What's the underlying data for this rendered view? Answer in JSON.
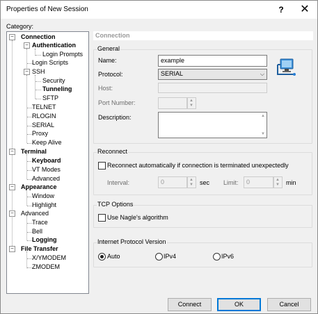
{
  "window": {
    "title": "Properties of New Session",
    "help_glyph": "?",
    "close_glyph": "✕"
  },
  "category_label": "Category:",
  "tree": {
    "connection": "Connection",
    "authentication": "Authentication",
    "login_prompts": "Login Prompts",
    "login_scripts": "Login Scripts",
    "ssh": "SSH",
    "security": "Security",
    "tunneling": "Tunneling",
    "sftp": "SFTP",
    "telnet": "TELNET",
    "rlogin": "RLOGIN",
    "serial": "SERIAL",
    "proxy": "Proxy",
    "keep_alive": "Keep Alive",
    "terminal": "Terminal",
    "keyboard": "Keyboard",
    "vt_modes": "VT Modes",
    "terminal_advanced": "Advanced",
    "appearance": "Appearance",
    "window": "Window",
    "highlight": "Highlight",
    "advanced": "Advanced",
    "trace": "Trace",
    "bell": "Bell",
    "logging": "Logging",
    "file_transfer": "File Transfer",
    "xymodem": "X/YMODEM",
    "zmodem": "ZMODEM",
    "collapse_glyph": "−"
  },
  "section_header": "Connection",
  "general": {
    "title": "General",
    "name_label": "Name:",
    "name_value": "example",
    "protocol_label": "Protocol:",
    "protocol_value": "SERIAL",
    "host_label": "Host:",
    "host_value": "",
    "port_label": "Port Number:",
    "port_value": "",
    "description_label": "Description:",
    "description_value": ""
  },
  "reconnect": {
    "title": "Reconnect",
    "checkbox_label": "Reconnect automatically if connection is terminated unexpectedly",
    "checked": false,
    "interval_label": "Interval:",
    "interval_value": "0",
    "interval_unit": "sec",
    "limit_label": "Limit:",
    "limit_value": "0",
    "limit_unit": "min"
  },
  "tcp_options": {
    "title": "TCP Options",
    "nagle_label": "Use Nagle's algorithm",
    "checked": false
  },
  "ip_version": {
    "title": "Internet Protocol Version",
    "options": [
      "Auto",
      "IPv4",
      "IPv6"
    ],
    "selected": "Auto"
  },
  "buttons": {
    "connect": "Connect",
    "ok": "OK",
    "cancel": "Cancel"
  },
  "icons": {
    "session": "computer-network-icon",
    "spin_up": "▲",
    "spin_down": "▼",
    "caret": "⌵",
    "scroll_up": "▲",
    "scroll_down": "▼"
  },
  "colors": {
    "accent": "#0078d7",
    "tree_border": "#828790",
    "section_header_text": "#9a9a9a"
  }
}
